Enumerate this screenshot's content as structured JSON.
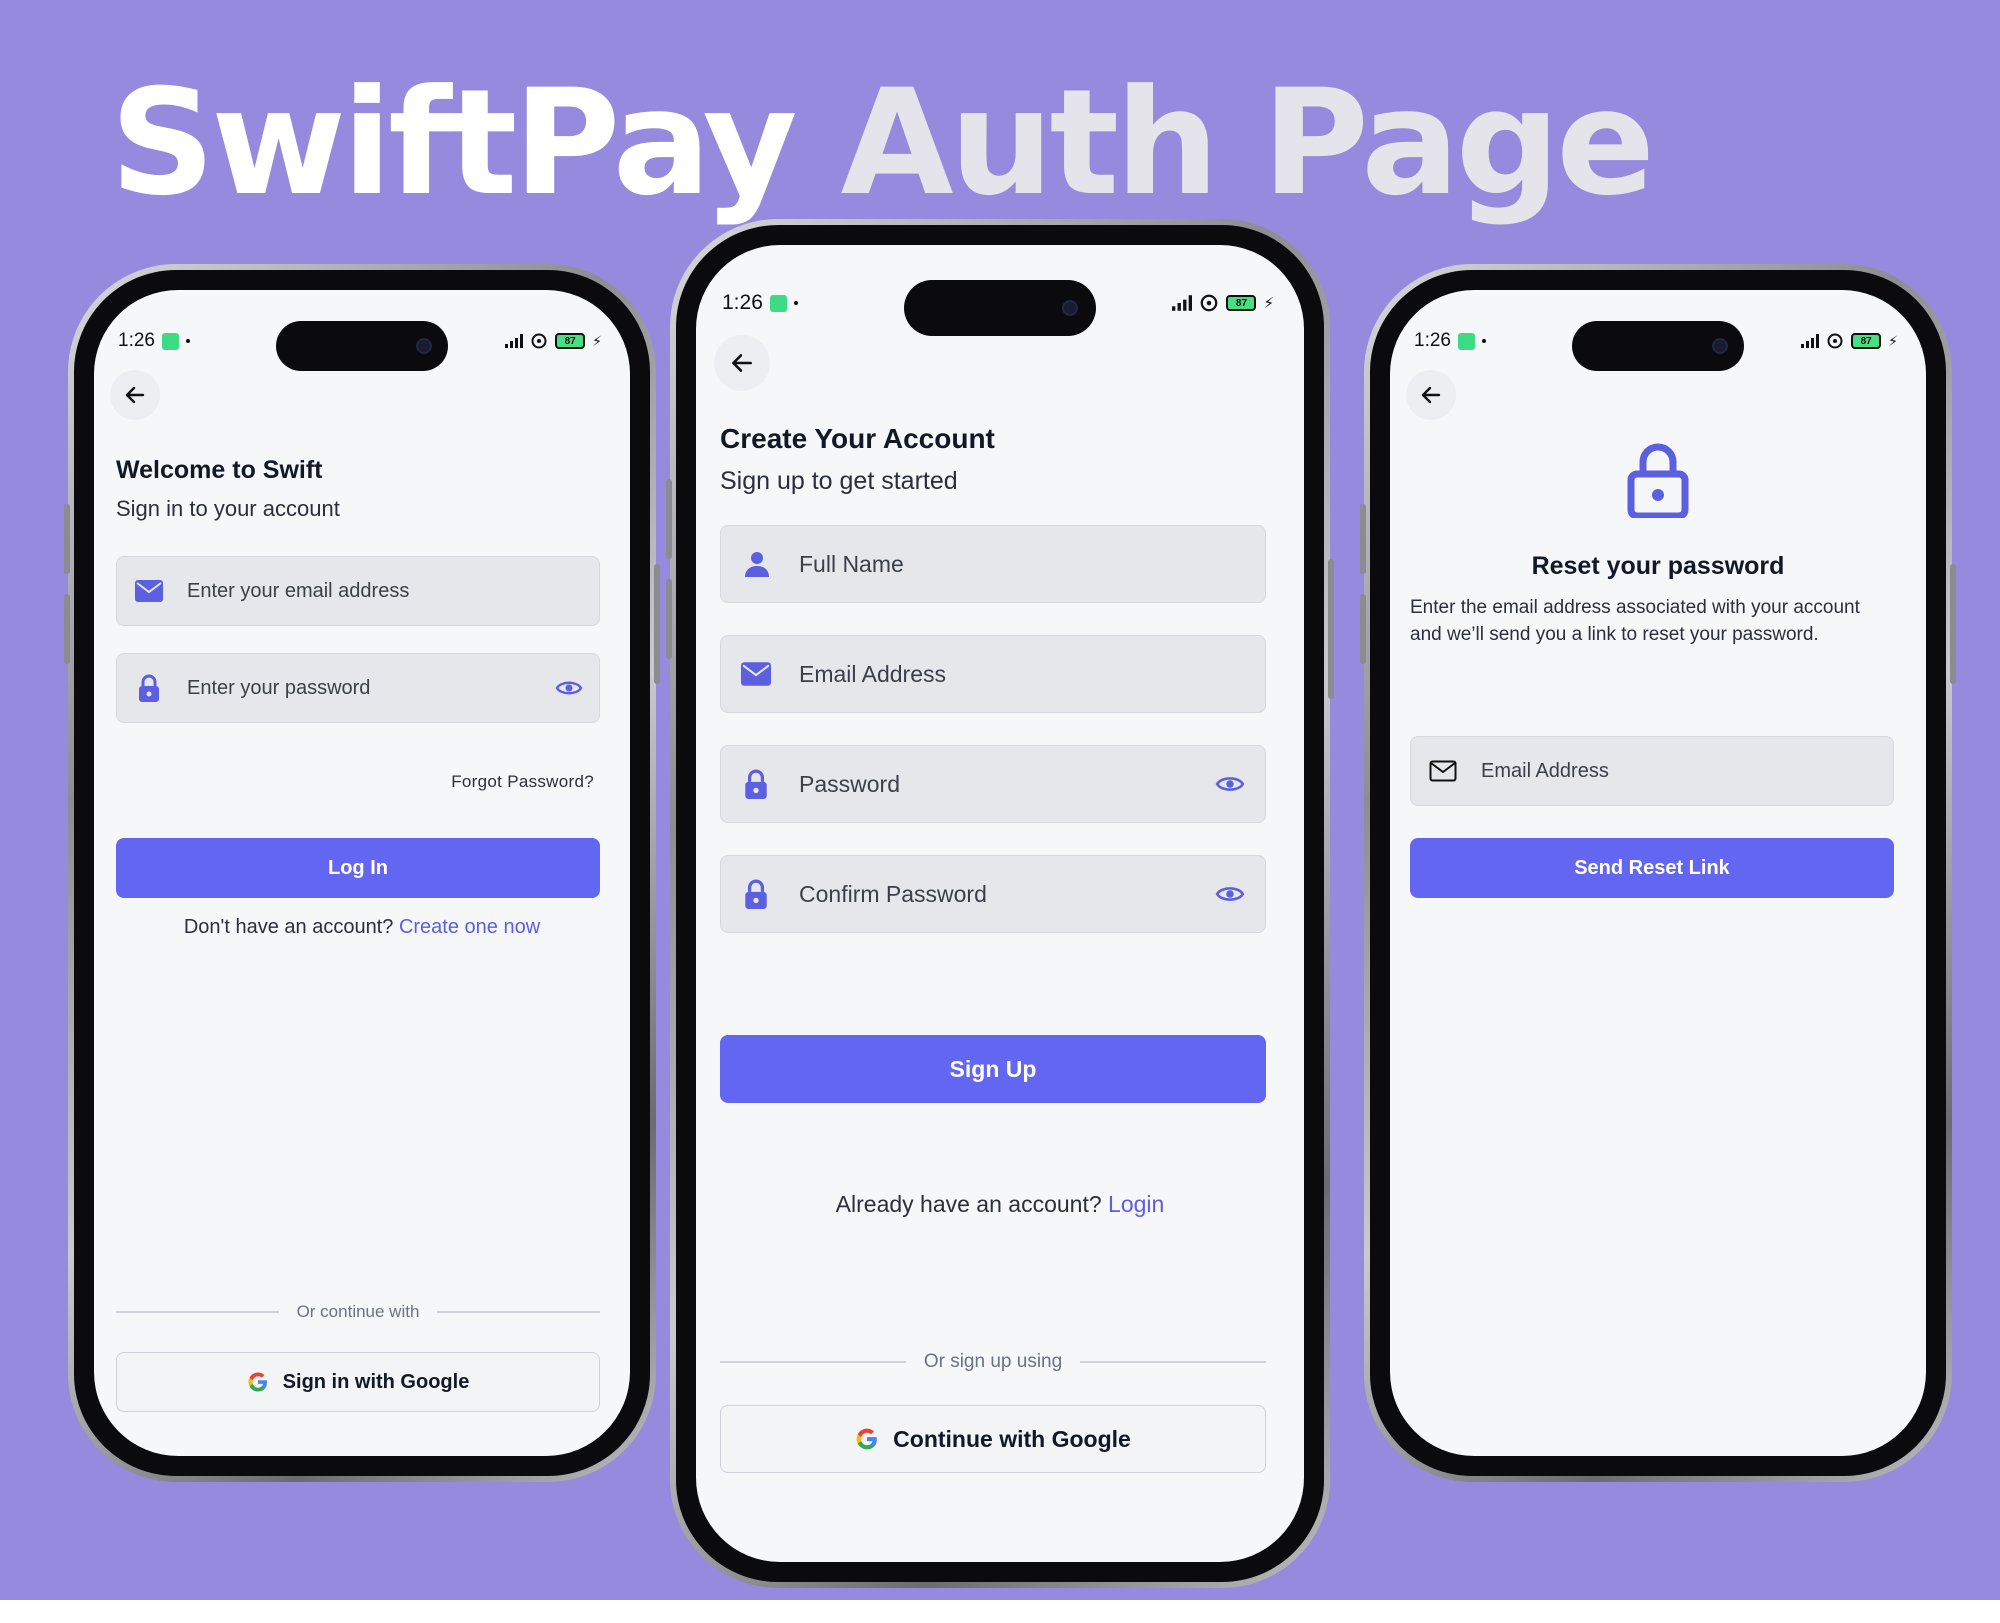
{
  "headline": {
    "word1": "SwiftPay",
    "word2": "Auth Page"
  },
  "status_bar": {
    "time": "1:26",
    "battery": "87"
  },
  "colors": {
    "background": "#958ade",
    "accent": "#6366f1",
    "link": "#5b5fe0"
  },
  "login": {
    "title": "Welcome to Swift",
    "subtitle": "Sign in to your account",
    "email_placeholder": "Enter your email address",
    "password_placeholder": "Enter your password",
    "forgot": "Forgot Password?",
    "login_button": "Log In",
    "no_account": "Don't have an account?",
    "create_link": "Create one now",
    "divider": "Or continue with",
    "google_button": "Sign in with Google"
  },
  "signup": {
    "title": "Create Your Account",
    "subtitle": "Sign up to get started",
    "fullname_placeholder": "Full Name",
    "email_placeholder": "Email Address",
    "password_placeholder": "Password",
    "confirm_placeholder": "Confirm Password",
    "signup_button": "Sign Up",
    "have_account": "Already have an account?",
    "login_link": "Login",
    "divider": "Or sign up using",
    "google_button": "Continue with Google"
  },
  "reset": {
    "title": "Reset your password",
    "description": "Enter the email address associated with your account and we’ll send you a link to reset your password.",
    "email_placeholder": "Email Address",
    "send_button": "Send Reset Link"
  }
}
